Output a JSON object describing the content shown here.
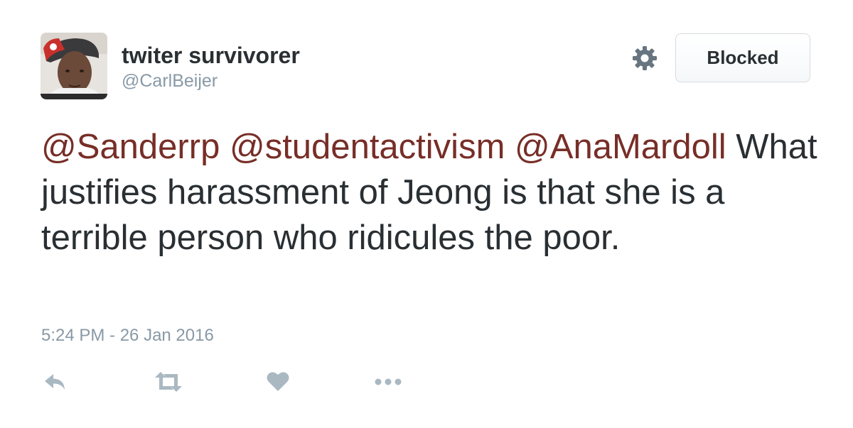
{
  "user": {
    "display_name": "twiter survivorer",
    "handle": "@CarlBeijer"
  },
  "follow_button": {
    "label": "Blocked"
  },
  "tweet": {
    "mentions": [
      "@Sanderrp",
      "@studentactivism",
      "@AnaMardoll"
    ],
    "body": "What justifies harassment of Jeong is that she is a terrible person who ridicules the poor.",
    "timestamp": "5:24 PM - 26 Jan 2016"
  },
  "actions": [
    "reply-icon",
    "retweet-icon",
    "like-icon",
    "more-icon"
  ],
  "colors": {
    "text": "#292f33",
    "secondary": "#8899a6",
    "mention": "#772e27",
    "icon": "#aab8c2"
  }
}
